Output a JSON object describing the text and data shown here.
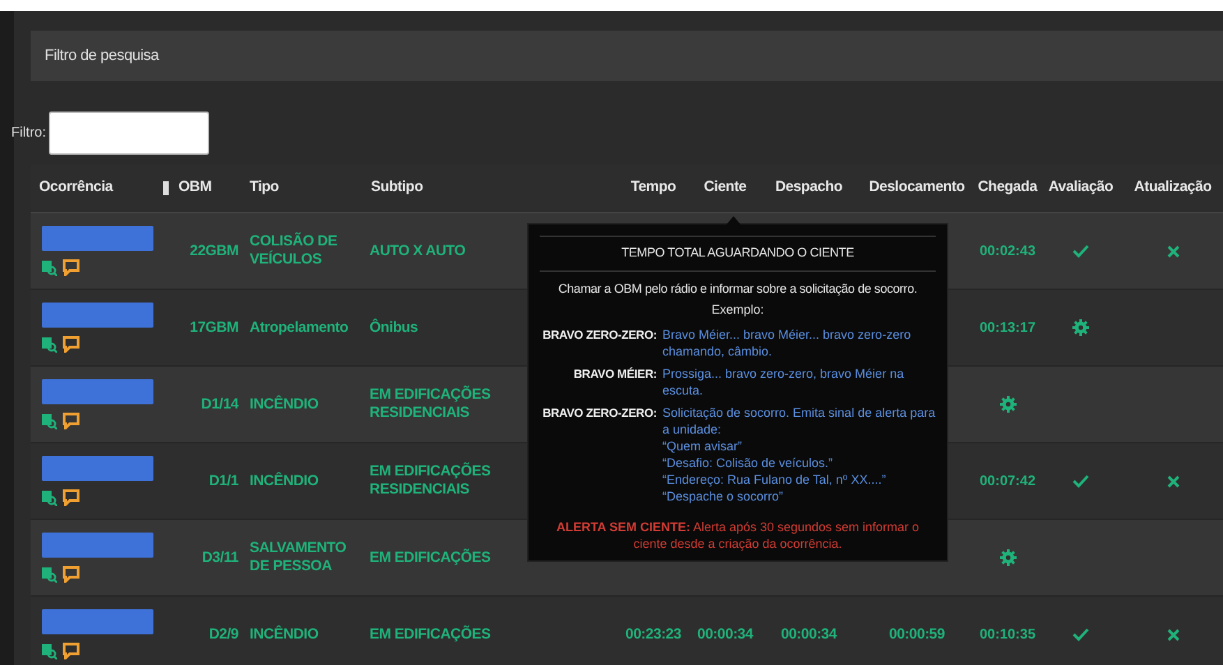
{
  "search_panel": {
    "title": "Filtro de pesquisa"
  },
  "filter": {
    "label": "Filtro:"
  },
  "table": {
    "columns": [
      "Ocorrência",
      "OBM",
      "Tipo",
      "Subtipo",
      "Tempo",
      "Ciente",
      "Despacho",
      "Deslocamento",
      "Chegada",
      "Avaliação",
      "Atualização"
    ],
    "rows": [
      {
        "obm": "22GBM",
        "tipo": "COLISÃO DE VEÍCULOS",
        "subtipo": "AUTO X AUTO",
        "chegada": {
          "kind": "time",
          "text": "00:02:43"
        },
        "avaliacao": {
          "kind": "check"
        },
        "atualizacao": {
          "kind": "x"
        }
      },
      {
        "obm": "17GBM",
        "tipo": "Atropelamento",
        "subtipo": "Ônibus",
        "chegada": {
          "kind": "time",
          "text": "00:13:17"
        },
        "avaliacao": {
          "kind": "gear"
        }
      },
      {
        "obm": "D1/14",
        "tipo": "INCÊNDIO",
        "subtipo": "EM EDIFICAÇÕES RESIDENCIAIS",
        "chegada": {
          "kind": "gear"
        }
      },
      {
        "obm": "D1/1",
        "tipo": "INCÊNDIO",
        "subtipo": "EM EDIFICAÇÕES RESIDENCIAIS",
        "chegada": {
          "kind": "time",
          "text": "00:07:42"
        },
        "avaliacao": {
          "kind": "check"
        },
        "atualizacao": {
          "kind": "x"
        }
      },
      {
        "obm": "D3/11",
        "tipo": "SALVAMENTO DE PESSOA",
        "subtipo": "EM EDIFICAÇÕES",
        "chegada": {
          "kind": "gear"
        }
      },
      {
        "obm": "D2/9",
        "tipo": "INCÊNDIO",
        "subtipo": "EM EDIFICAÇÕES",
        "tempo": "00:23:23",
        "ciente": "00:00:34",
        "despacho": "00:00:34",
        "deslocamento": "00:00:59",
        "chegada": {
          "kind": "time",
          "text": "00:10:35"
        },
        "avaliacao": {
          "kind": "check"
        },
        "atualizacao": {
          "kind": "x"
        }
      }
    ]
  },
  "tooltip": {
    "title": "TEMPO TOTAL AGUARDANDO O CIENTE",
    "intro": "Chamar a OBM pelo rádio e informar sobre a solicitação de socorro.",
    "example_label": "Exemplo:",
    "dialogue": [
      {
        "speaker": "BRAVO ZERO-ZERO:",
        "lines": [
          "Bravo Méier... bravo Méier... bravo zero-zero chamando, câmbio."
        ]
      },
      {
        "speaker": "BRAVO MÉIER:",
        "lines": [
          "Prossiga... bravo zero-zero, bravo Méier na escuta."
        ]
      },
      {
        "speaker": "BRAVO ZERO-ZERO:",
        "lines": [
          "Solicitação de socorro. Emita sinal de alerta para a unidade:",
          "“Quem avisar”",
          "“Desafio: Colisão de veículos.”",
          "“Endereço: Rua Fulano de Tal, nº XX....”",
          "“Despache o socorro”"
        ]
      }
    ],
    "alert_label": "ALERTA SEM CIENTE:",
    "alert_text": "Alerta após 30 segundos sem informar o ciente desde a criação da ocorrência."
  }
}
